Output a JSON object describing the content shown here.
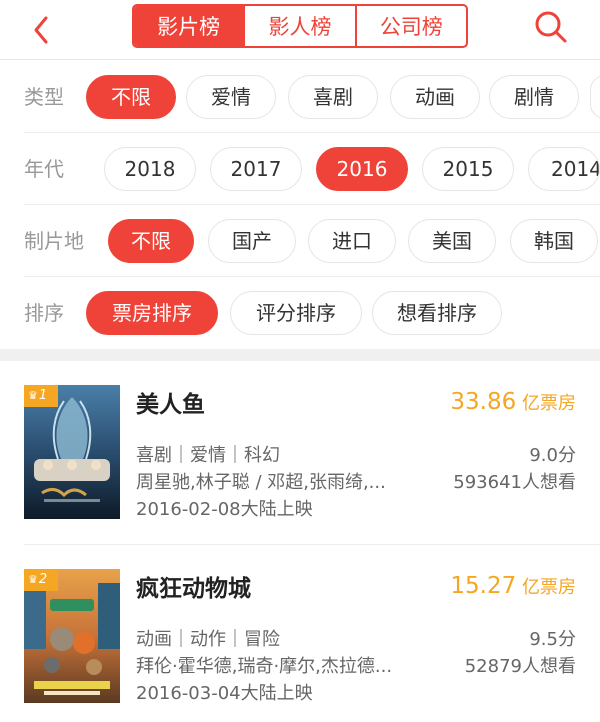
{
  "header": {
    "tabs": [
      {
        "label": "影片榜",
        "active": true
      },
      {
        "label": "影人榜",
        "active": false
      },
      {
        "label": "公司榜",
        "active": false
      }
    ],
    "back_icon": "chevron-left-icon",
    "search_icon": "search-icon"
  },
  "filters": {
    "type": {
      "label": "类型",
      "options": [
        "不限",
        "爱情",
        "喜剧",
        "动画",
        "剧情"
      ],
      "selected": "不限"
    },
    "year": {
      "label": "年代",
      "options": [
        "2018",
        "2017",
        "2016",
        "2015",
        "2014"
      ],
      "selected": "2016"
    },
    "region": {
      "label": "制片地",
      "options": [
        "不限",
        "国产",
        "进口",
        "美国",
        "韩国"
      ],
      "selected": "不限"
    },
    "sort": {
      "label": "排序",
      "options": [
        "票房排序",
        "评分排序",
        "想看排序"
      ],
      "selected": "票房排序"
    }
  },
  "movies": [
    {
      "rank": "1",
      "title": "美人鱼",
      "box_num": "33.86",
      "box_unit": "亿票房",
      "genres": "喜剧｜爱情｜科幻",
      "actors": "周星驰,林子聪 / 邓超,张雨绮,...",
      "date": "2016-02-08大陆上映",
      "score": "9.0分",
      "want": "593641人想看"
    },
    {
      "rank": "2",
      "title": "疯狂动物城",
      "box_num": "15.27",
      "box_unit": "亿票房",
      "genres": "动画｜动作｜冒险",
      "actors": "拜伦·霍华德,瑞奇·摩尔,杰拉德...",
      "date": "2016-03-04大陆上映",
      "score": "9.5分",
      "want": "52879人想看"
    }
  ],
  "colors": {
    "accent": "#ef4238",
    "gold": "#f5a623"
  }
}
